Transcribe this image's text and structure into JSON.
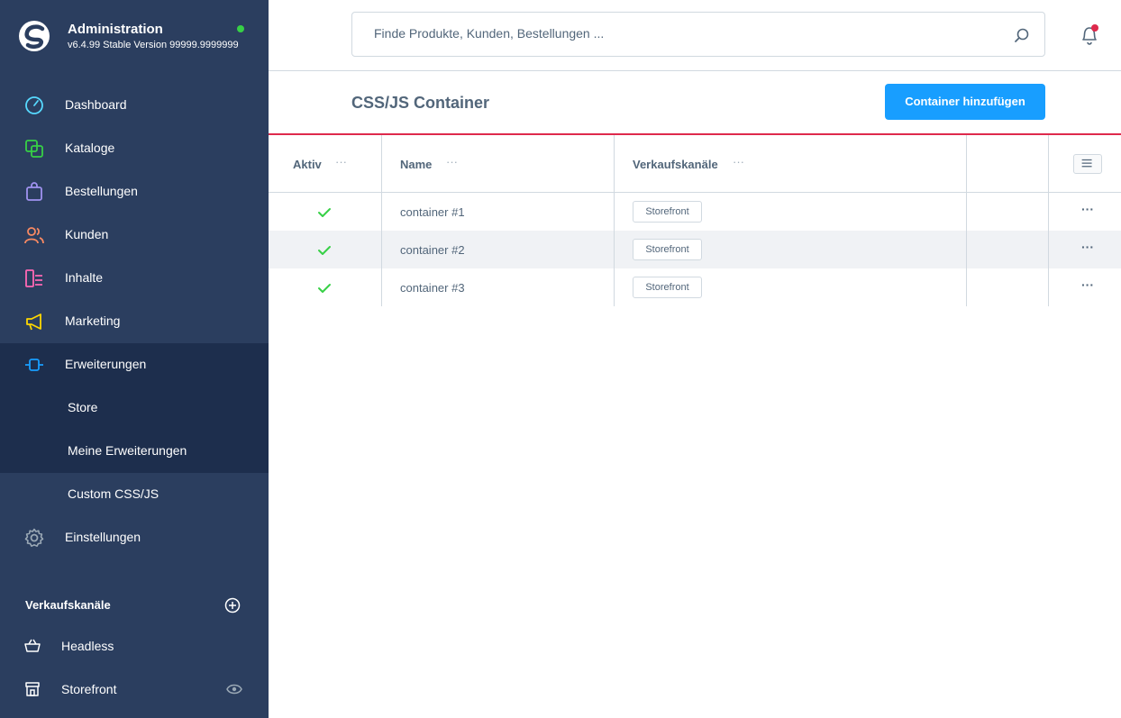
{
  "brand": {
    "title": "Administration",
    "version": "v6.4.99 Stable Version 99999.9999999",
    "status_color": "#37d046"
  },
  "sidebar": {
    "items": [
      {
        "label": "Dashboard",
        "icon": "gauge-icon",
        "color": "#57d9ff"
      },
      {
        "label": "Kataloge",
        "icon": "catalog-icon",
        "color": "#37d046"
      },
      {
        "label": "Bestellungen",
        "icon": "shopping-bag-icon",
        "color": "#a092f0"
      },
      {
        "label": "Kunden",
        "icon": "users-icon",
        "color": "#f88962"
      },
      {
        "label": "Inhalte",
        "icon": "content-icon",
        "color": "#ff68b4"
      },
      {
        "label": "Marketing",
        "icon": "megaphone-icon",
        "color": "#ffd700"
      },
      {
        "label": "Erweiterungen",
        "icon": "plugin-icon",
        "color": "#189eff"
      },
      {
        "label": "Einstellungen",
        "icon": "gear-icon",
        "color": "#9aa8b5"
      }
    ],
    "sub_items": [
      {
        "label": "Store"
      },
      {
        "label": "Meine Erweiterungen"
      },
      {
        "label": "Custom CSS/JS"
      }
    ],
    "sales_channels_header": "Verkaufskanäle",
    "sales_channels": [
      {
        "label": "Headless",
        "icon": "basket-icon"
      },
      {
        "label": "Storefront",
        "icon": "storefront-icon"
      }
    ]
  },
  "search": {
    "placeholder": "Finde Produkte, Kunden, Bestellungen ..."
  },
  "page": {
    "title": "CSS/JS Container",
    "primary_button": "Container hinzufügen",
    "accent_color": "#189eff",
    "divider_color": "#de294c"
  },
  "grid": {
    "columns": [
      "Aktiv",
      "Name",
      "Verkaufskanäle"
    ],
    "column_menu": "···",
    "rows": [
      {
        "active": true,
        "name": "container #1",
        "channel": "Storefront",
        "menu": "···"
      },
      {
        "active": true,
        "name": "container #2",
        "channel": "Storefront",
        "menu": "···"
      },
      {
        "active": true,
        "name": "container #3",
        "channel": "Storefront",
        "menu": "···"
      }
    ]
  }
}
